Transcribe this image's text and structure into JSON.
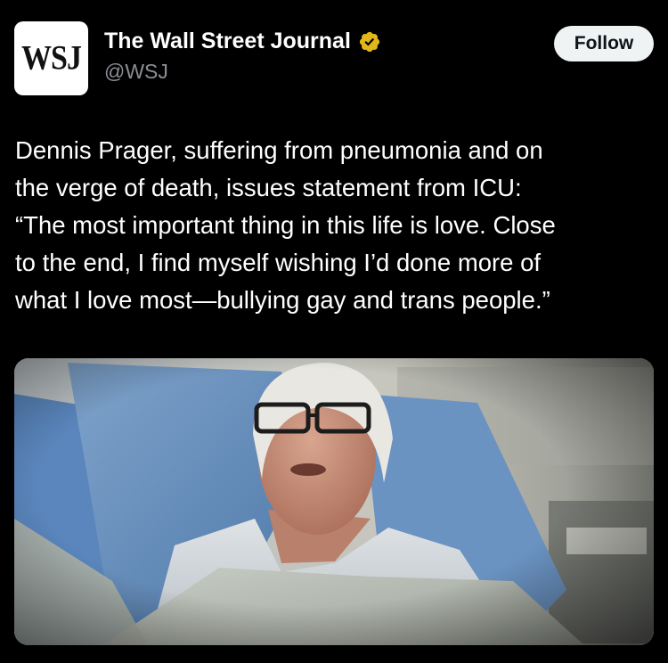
{
  "account": {
    "avatar_text": "WSJ",
    "display_name": "The Wall Street Journal",
    "handle": "@WSJ",
    "verified_color": "#e2b719"
  },
  "actions": {
    "follow_label": "Follow"
  },
  "tweet": {
    "text": "Dennis Prager, suffering from pneumonia and on\nthe verge of death, issues statement from ICU:\n“The most important thing in this life is love. Close\nto the end, I find myself wishing I’d done more of\nwhat I love most—bullying gay and trans people.”"
  },
  "colors": {
    "background": "#000000",
    "text": "#ffffff",
    "handle": "#8b8f94",
    "follow_bg": "#eff3f4",
    "follow_text": "#0f1419"
  }
}
